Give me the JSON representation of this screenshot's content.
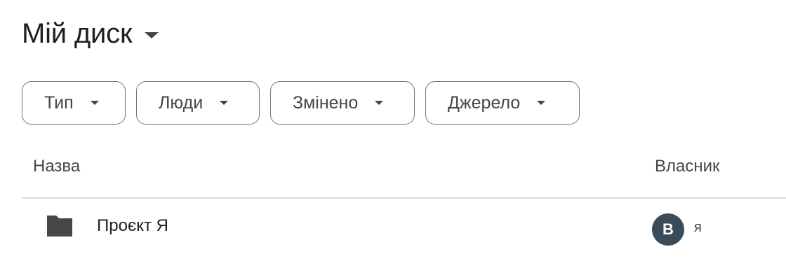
{
  "header": {
    "title": "Мій диск"
  },
  "filters": [
    {
      "label": "Тип"
    },
    {
      "label": "Люди"
    },
    {
      "label": "Змінено"
    },
    {
      "label": "Джерело"
    }
  ],
  "columns": {
    "name": "Назва",
    "owner": "Власник"
  },
  "rows": [
    {
      "name": "Проєкт Я",
      "icon": "folder-icon",
      "owner_initial": "В",
      "owner_name": "я",
      "owner_avatar_color": "#3c4b58"
    }
  ],
  "colors": {
    "text_primary": "#1f1f1f",
    "text_secondary": "#444746",
    "chip_border": "#747775",
    "divider": "#dadce0",
    "folder": "#444746"
  }
}
